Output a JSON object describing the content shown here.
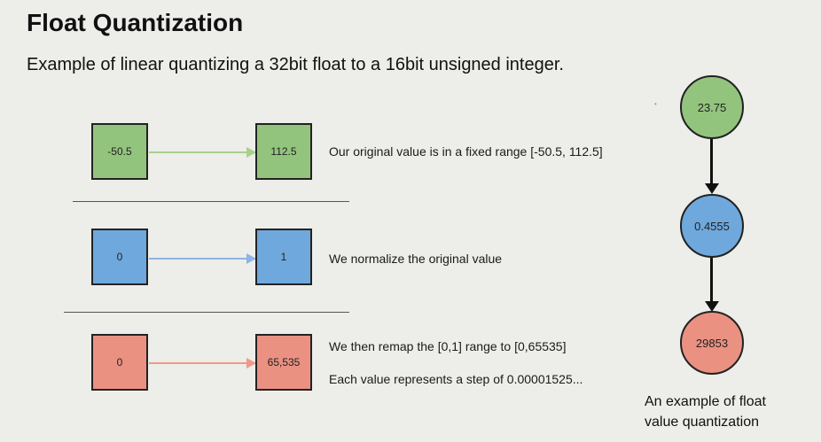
{
  "title": "Float Quantization",
  "subtitle": "Example of linear quantizing a 32bit float to a 16bit unsigned integer.",
  "rows": [
    {
      "from_value": "-50.5",
      "to_value": "112.5",
      "descriptions": [
        "Our original value is in a fixed range [-50.5, 112.5]"
      ],
      "color": "#93c47d"
    },
    {
      "from_value": "0",
      "to_value": "1",
      "descriptions": [
        "We normalize the original value"
      ],
      "color": "#6fa8dc"
    },
    {
      "from_value": "0",
      "to_value": "65,535",
      "descriptions": [
        "We then remap the [0,1] range to [0,65535]",
        "Each value represents a step of 0.00001525..."
      ],
      "color": "#ea9182"
    }
  ],
  "example": {
    "nodes": [
      {
        "value": "23.75",
        "color": "#93c47d"
      },
      {
        "value": "0.4555",
        "color": "#6fa8dc"
      },
      {
        "value": "29853",
        "color": "#ea9182"
      }
    ],
    "caption_line1": "An example of float",
    "caption_line2": "value quantization"
  }
}
